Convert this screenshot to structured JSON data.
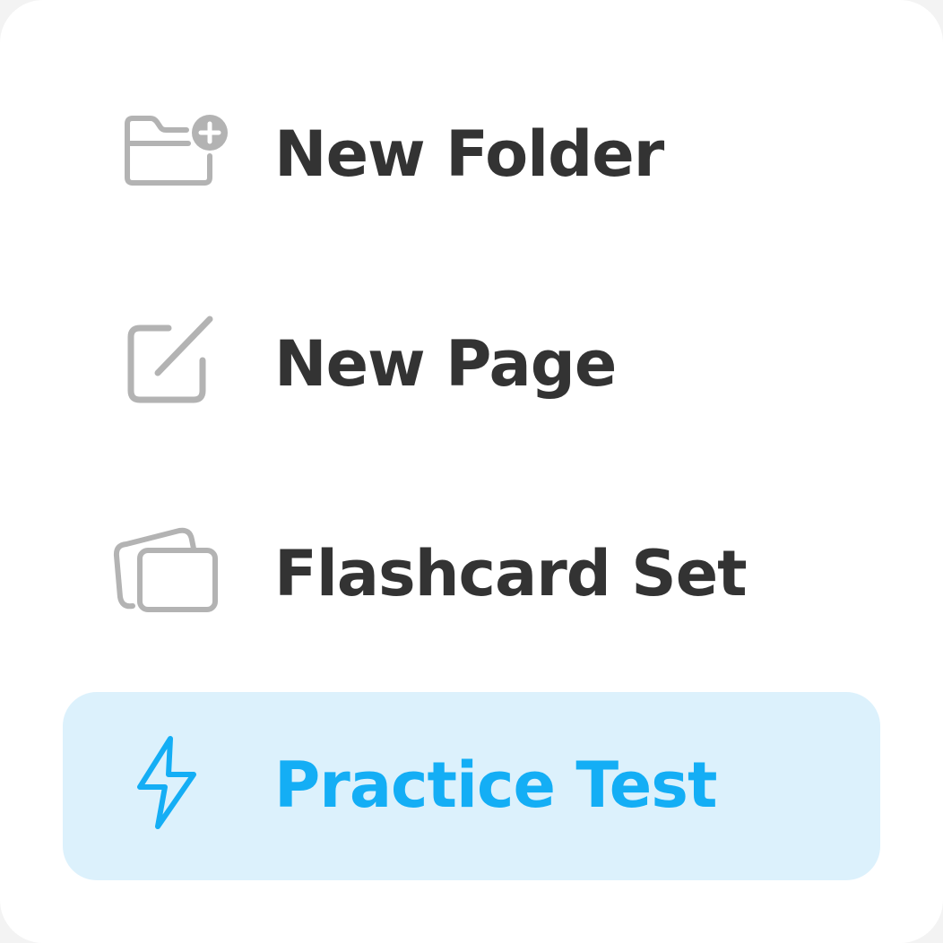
{
  "menu": {
    "items": [
      {
        "label": "New Folder",
        "icon": "folder-plus-icon",
        "active": false
      },
      {
        "label": "New Page",
        "icon": "edit-page-icon",
        "active": false
      },
      {
        "label": "Flashcard Set",
        "icon": "flashcards-icon",
        "active": false
      },
      {
        "label": "Practice Test",
        "icon": "lightning-icon",
        "active": true
      }
    ]
  },
  "colors": {
    "text": "#333333",
    "icon": "#b3b3b3",
    "accent": "#14aef5",
    "active_background": "#dcf1fc"
  }
}
